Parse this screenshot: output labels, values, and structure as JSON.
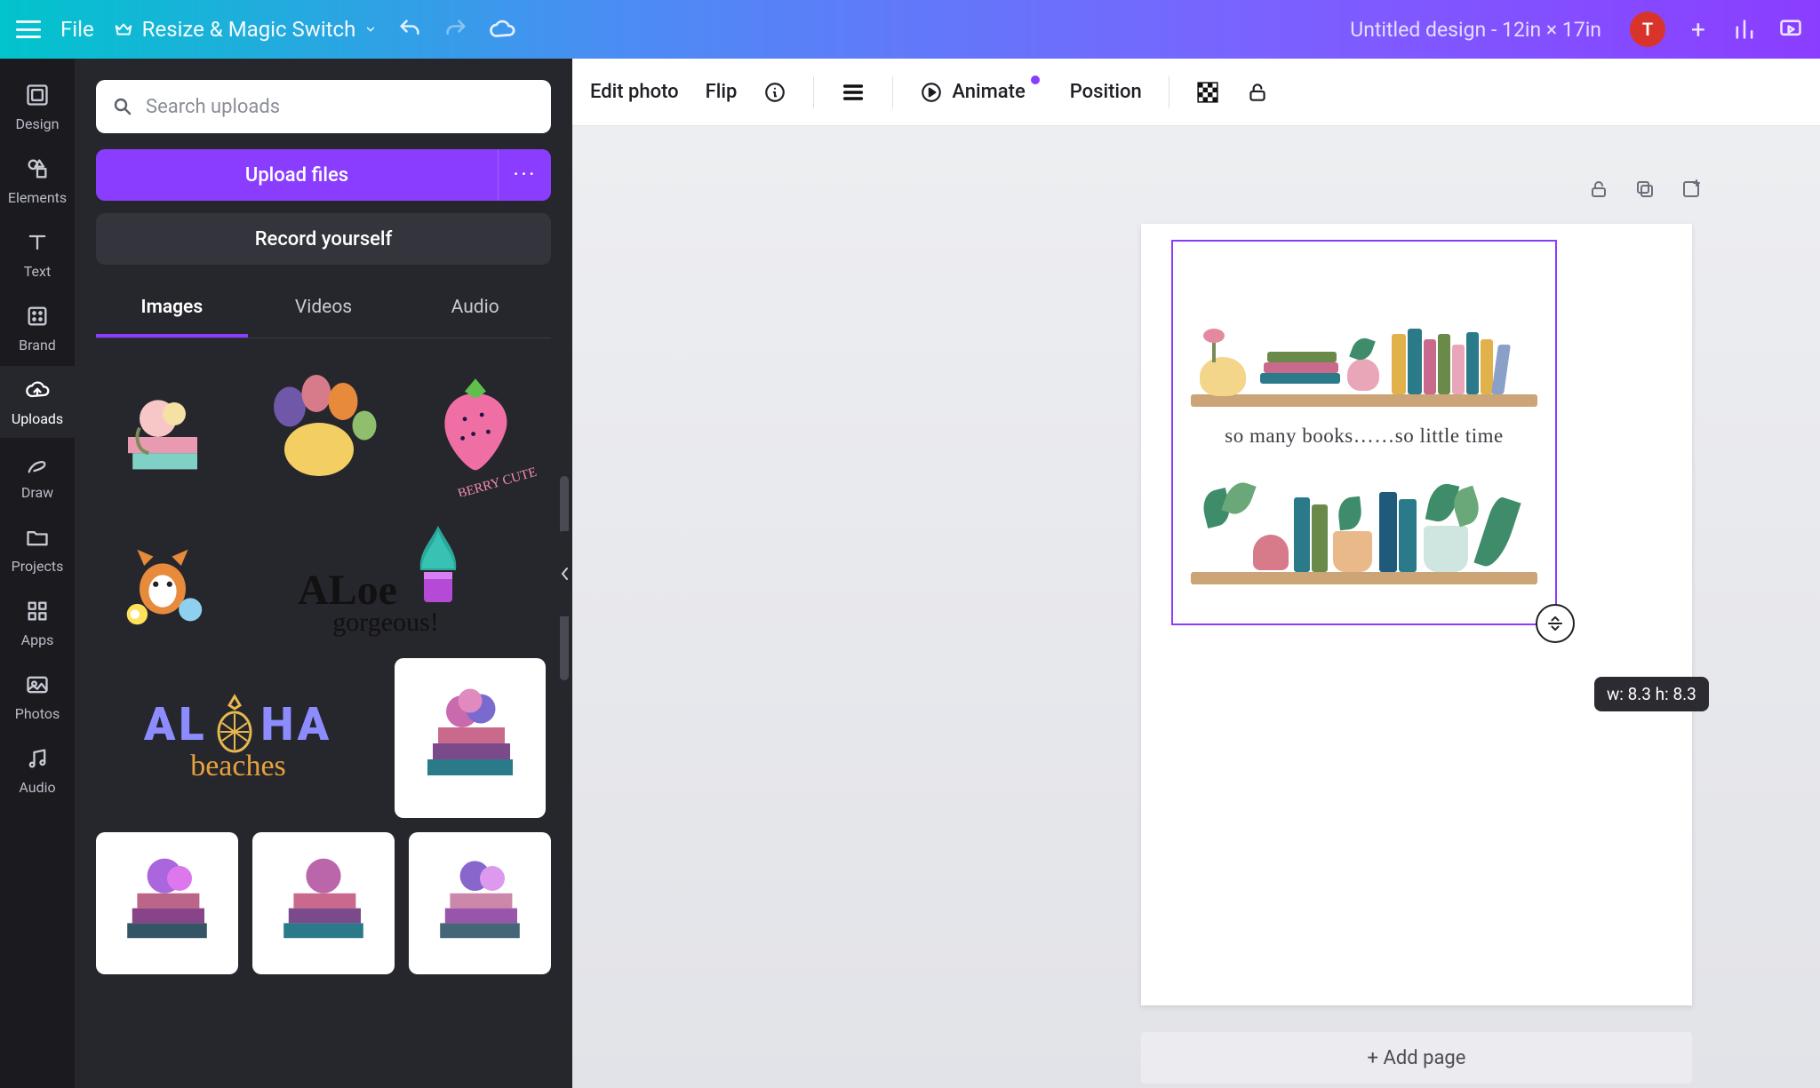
{
  "topbar": {
    "file": "File",
    "resize": "Resize & Magic Switch",
    "docTitle": "Untitled design - 12in × 17in",
    "avatarInitial": "T"
  },
  "rail": {
    "items": [
      {
        "id": "design",
        "label": "Design"
      },
      {
        "id": "elements",
        "label": "Elements"
      },
      {
        "id": "text",
        "label": "Text"
      },
      {
        "id": "brand",
        "label": "Brand"
      },
      {
        "id": "uploads",
        "label": "Uploads",
        "active": true
      },
      {
        "id": "draw",
        "label": "Draw"
      },
      {
        "id": "projects",
        "label": "Projects"
      },
      {
        "id": "apps",
        "label": "Apps"
      },
      {
        "id": "photos",
        "label": "Photos"
      },
      {
        "id": "audio",
        "label": "Audio"
      }
    ]
  },
  "panel": {
    "searchPlaceholder": "Search uploads",
    "uploadLabel": "Upload files",
    "uploadMore": "···",
    "recordLabel": "Record yourself",
    "tabs": {
      "images": "Images",
      "videos": "Videos",
      "audio": "Audio"
    }
  },
  "ctx": {
    "editPhoto": "Edit photo",
    "flip": "Flip",
    "animate": "Animate",
    "position": "Position"
  },
  "stage": {
    "dimTooltip": "w: 8.3 h: 8.3",
    "addPage": "+ Add page",
    "artCaption": "so many books……so little time"
  },
  "thumbText": {
    "berry": "BERRY CUTE",
    "aloe1": "ALoe",
    "aloe2": "gorgeous!",
    "aloha1": "ALOHA",
    "aloha2": "beaches"
  },
  "colors": {
    "accent": "#8b3dff",
    "panel": "#26262d",
    "rail": "#1a1a1f"
  }
}
